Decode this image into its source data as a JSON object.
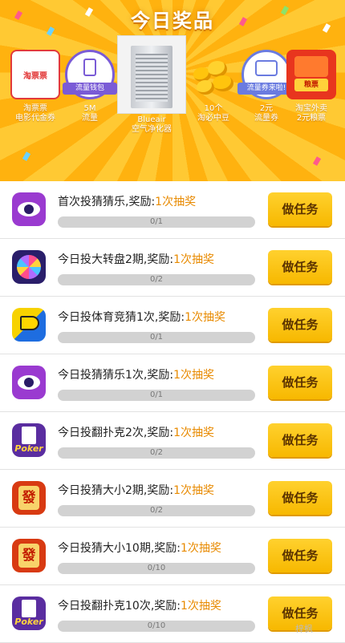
{
  "banner": {
    "title": "今日奖品",
    "prizes": [
      {
        "line1": "淘票票",
        "line2": "电影代金券",
        "pic_text": "淘票票"
      },
      {
        "line1": "5M",
        "line2": "流量",
        "pic_text": "流量钱包"
      },
      {
        "line1": "Blueair",
        "line2": "空气净化器",
        "pic_text": ""
      },
      {
        "line1": "10个",
        "line2": "淘必中豆",
        "pic_text": ""
      },
      {
        "line1": "2元",
        "line2": "流量券",
        "pic_text": "流量券来啦!"
      },
      {
        "line1": "淘宝外卖",
        "line2": "2元粮票",
        "pic_text": "粮票"
      }
    ]
  },
  "tasks": [
    {
      "title": "首次投猜猜乐,奖励:",
      "reward": "1次抽奖",
      "progress": "0/1",
      "fraction": 0,
      "button": "做任务",
      "icon": "eye-icon"
    },
    {
      "title": "今日投大转盘2期,奖励:",
      "reward": "1次抽奖",
      "progress": "0/2",
      "fraction": 0,
      "button": "做任务",
      "icon": "wheel-icon"
    },
    {
      "title": "今日投体育竞猜1次,奖励:",
      "reward": "1次抽奖",
      "progress": "0/1",
      "fraction": 0,
      "button": "做任务",
      "icon": "sport-horn-icon"
    },
    {
      "title": "今日投猜猜乐1次,奖励:",
      "reward": "1次抽奖",
      "progress": "0/1",
      "fraction": 0,
      "button": "做任务",
      "icon": "eye-icon"
    },
    {
      "title": "今日投翻扑克2次,奖励:",
      "reward": "1次抽奖",
      "progress": "0/2",
      "fraction": 0,
      "button": "做任务",
      "icon": "poker-icon"
    },
    {
      "title": "今日投猜大小2期,奖励:",
      "reward": "1次抽奖",
      "progress": "0/2",
      "fraction": 0,
      "button": "做任务",
      "icon": "dice-icon"
    },
    {
      "title": "今日投猜大小10期,奖励:",
      "reward": "1次抽奖",
      "progress": "0/10",
      "fraction": 0,
      "button": "做任务",
      "icon": "dice-icon"
    },
    {
      "title": "今日投翻扑克10次,奖励:",
      "reward": "1次抽奖",
      "progress": "0/10",
      "fraction": 0,
      "button": "做任务",
      "icon": "poker-icon"
    }
  ],
  "icon_texts": {
    "poker": "Poker",
    "dice": "發"
  },
  "watermark": "梓枫",
  "colors": {
    "accent": "#f7b800",
    "reward": "#e88a00",
    "banner_light": "#ffc933",
    "banner_dark": "#ffb20f"
  }
}
